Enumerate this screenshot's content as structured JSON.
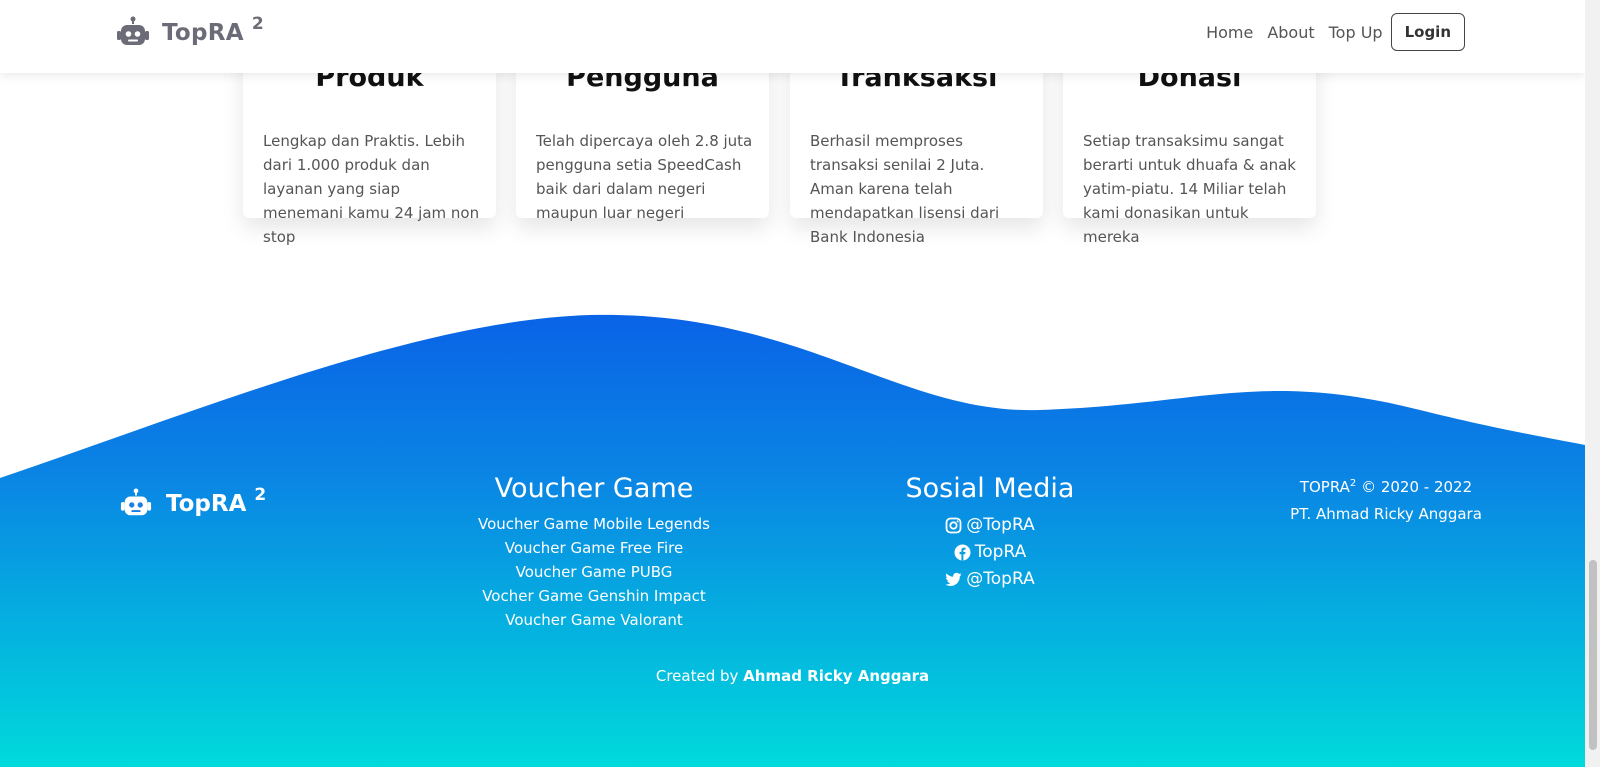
{
  "navbar": {
    "brand": "TopRA",
    "brand_sup": "2",
    "links": [
      "Home",
      "About",
      "Top Up"
    ],
    "login_label": "Login"
  },
  "cards": [
    {
      "title": "Produk",
      "text": "Lengkap dan Praktis. Lebih dari 1.000 produk dan layanan yang siap menemani kamu 24 jam non stop"
    },
    {
      "title": "Pengguna",
      "text": "Telah dipercaya oleh 2.8 juta pengguna setia SpeedCash baik dari dalam negeri maupun luar negeri"
    },
    {
      "title": "Tranksaksi",
      "text": "Berhasil memproses transaksi senilai 2 Juta. Aman karena telah mendapatkan lisensi dari Bank Indonesia"
    },
    {
      "title": "Donasi",
      "text": "Setiap transaksimu sangat berarti untuk dhuafa & anak yatim-piatu. 14 Miliar telah kami donasikan untuk mereka"
    }
  ],
  "footer": {
    "brand": "TopRA",
    "brand_sup": "2",
    "voucher": {
      "title": "Voucher Game",
      "links": [
        "Voucher Game Mobile Legends",
        "Voucher Game Free Fire",
        "Voucher Game PUBG",
        "Vocher Game Genshin Impact",
        "Voucher Game Valorant"
      ]
    },
    "social": {
      "title": "Sosial Media",
      "instagram": "@TopRA",
      "facebook": "TopRA",
      "twitter": "@TopRA"
    },
    "copyright": {
      "name": "TOPRA",
      "sup": "2",
      "years": "© 2020 - 2022",
      "company": "PT. Ahmad Ricky Anggara"
    },
    "created_prefix": "Created by",
    "created_name": "Ahmad Ricky Anggara"
  },
  "colors": {
    "gradient_top": "#0a6be8",
    "gradient_bottom": "#00d8dc",
    "card_title": "#111111",
    "card_text": "#555555"
  }
}
